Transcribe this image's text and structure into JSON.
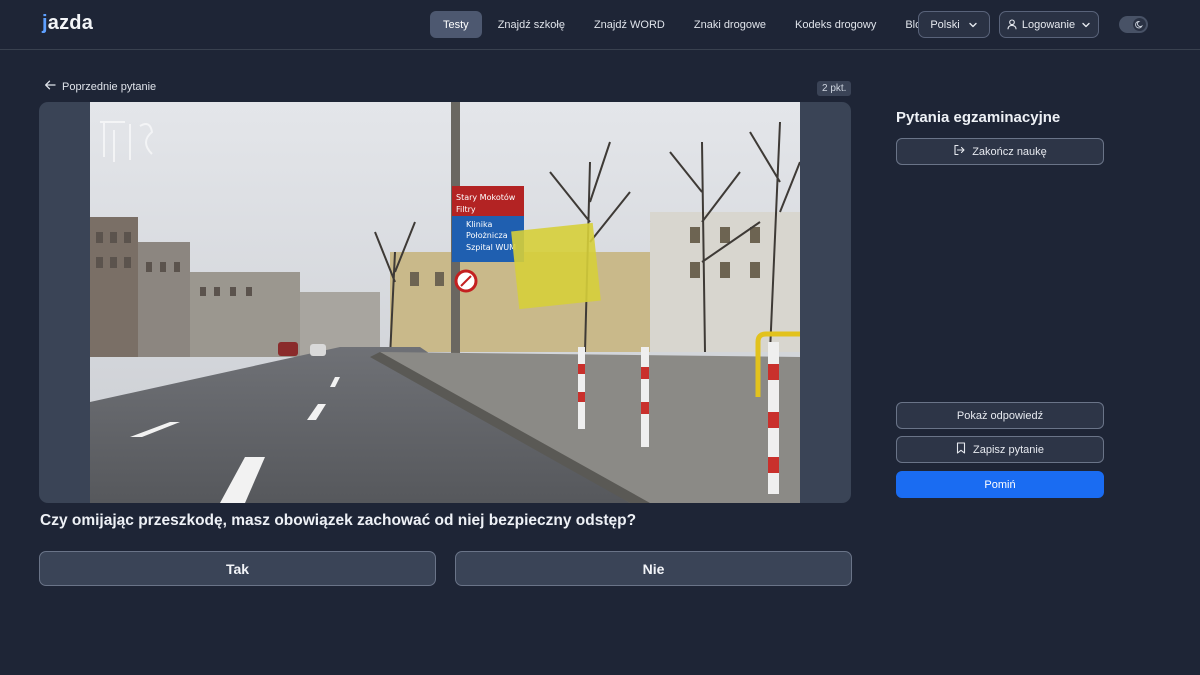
{
  "header": {
    "logo_text": "jazda",
    "nav": [
      {
        "label": "Testy",
        "active": true
      },
      {
        "label": "Znajdź szkołę",
        "active": false
      },
      {
        "label": "Znajdź WORD",
        "active": false
      },
      {
        "label": "Znaki drogowe",
        "active": false
      },
      {
        "label": "Kodeks drogowy",
        "active": false
      },
      {
        "label": "Blog",
        "active": false
      }
    ],
    "language": "Polski",
    "login": "Logowanie",
    "theme_mode": "dark"
  },
  "question": {
    "prev_label": "Poprzednie pytanie",
    "points": "2 pkt.",
    "text": "Czy omijając przeszkodę, masz obowiązek zachować od niej bezpieczny odstęp?",
    "answers": [
      "Tak",
      "Nie"
    ]
  },
  "sign": {
    "line1": "Stary Mokotów",
    "line2": "Filtry",
    "line3": "Klinika",
    "line4": "Położnicza",
    "line5": "Szpital WUM"
  },
  "sidebar": {
    "title": "Pytania egzaminacyjne",
    "end_label": "Zakończ naukę",
    "show_answer_label": "Pokaż odpowiedź",
    "save_label": "Zapisz pytanie",
    "skip_label": "Pomiń"
  },
  "colors": {
    "background": "#1e2536",
    "accent": "#1a6cf2",
    "nav_active": "#4d5870"
  },
  "icons": {
    "back": "arrow-left-icon",
    "language_chevron": "chevron-down-icon",
    "user": "user-icon",
    "theme": "moon-icon",
    "end": "logout-icon",
    "save": "bookmark-icon"
  }
}
